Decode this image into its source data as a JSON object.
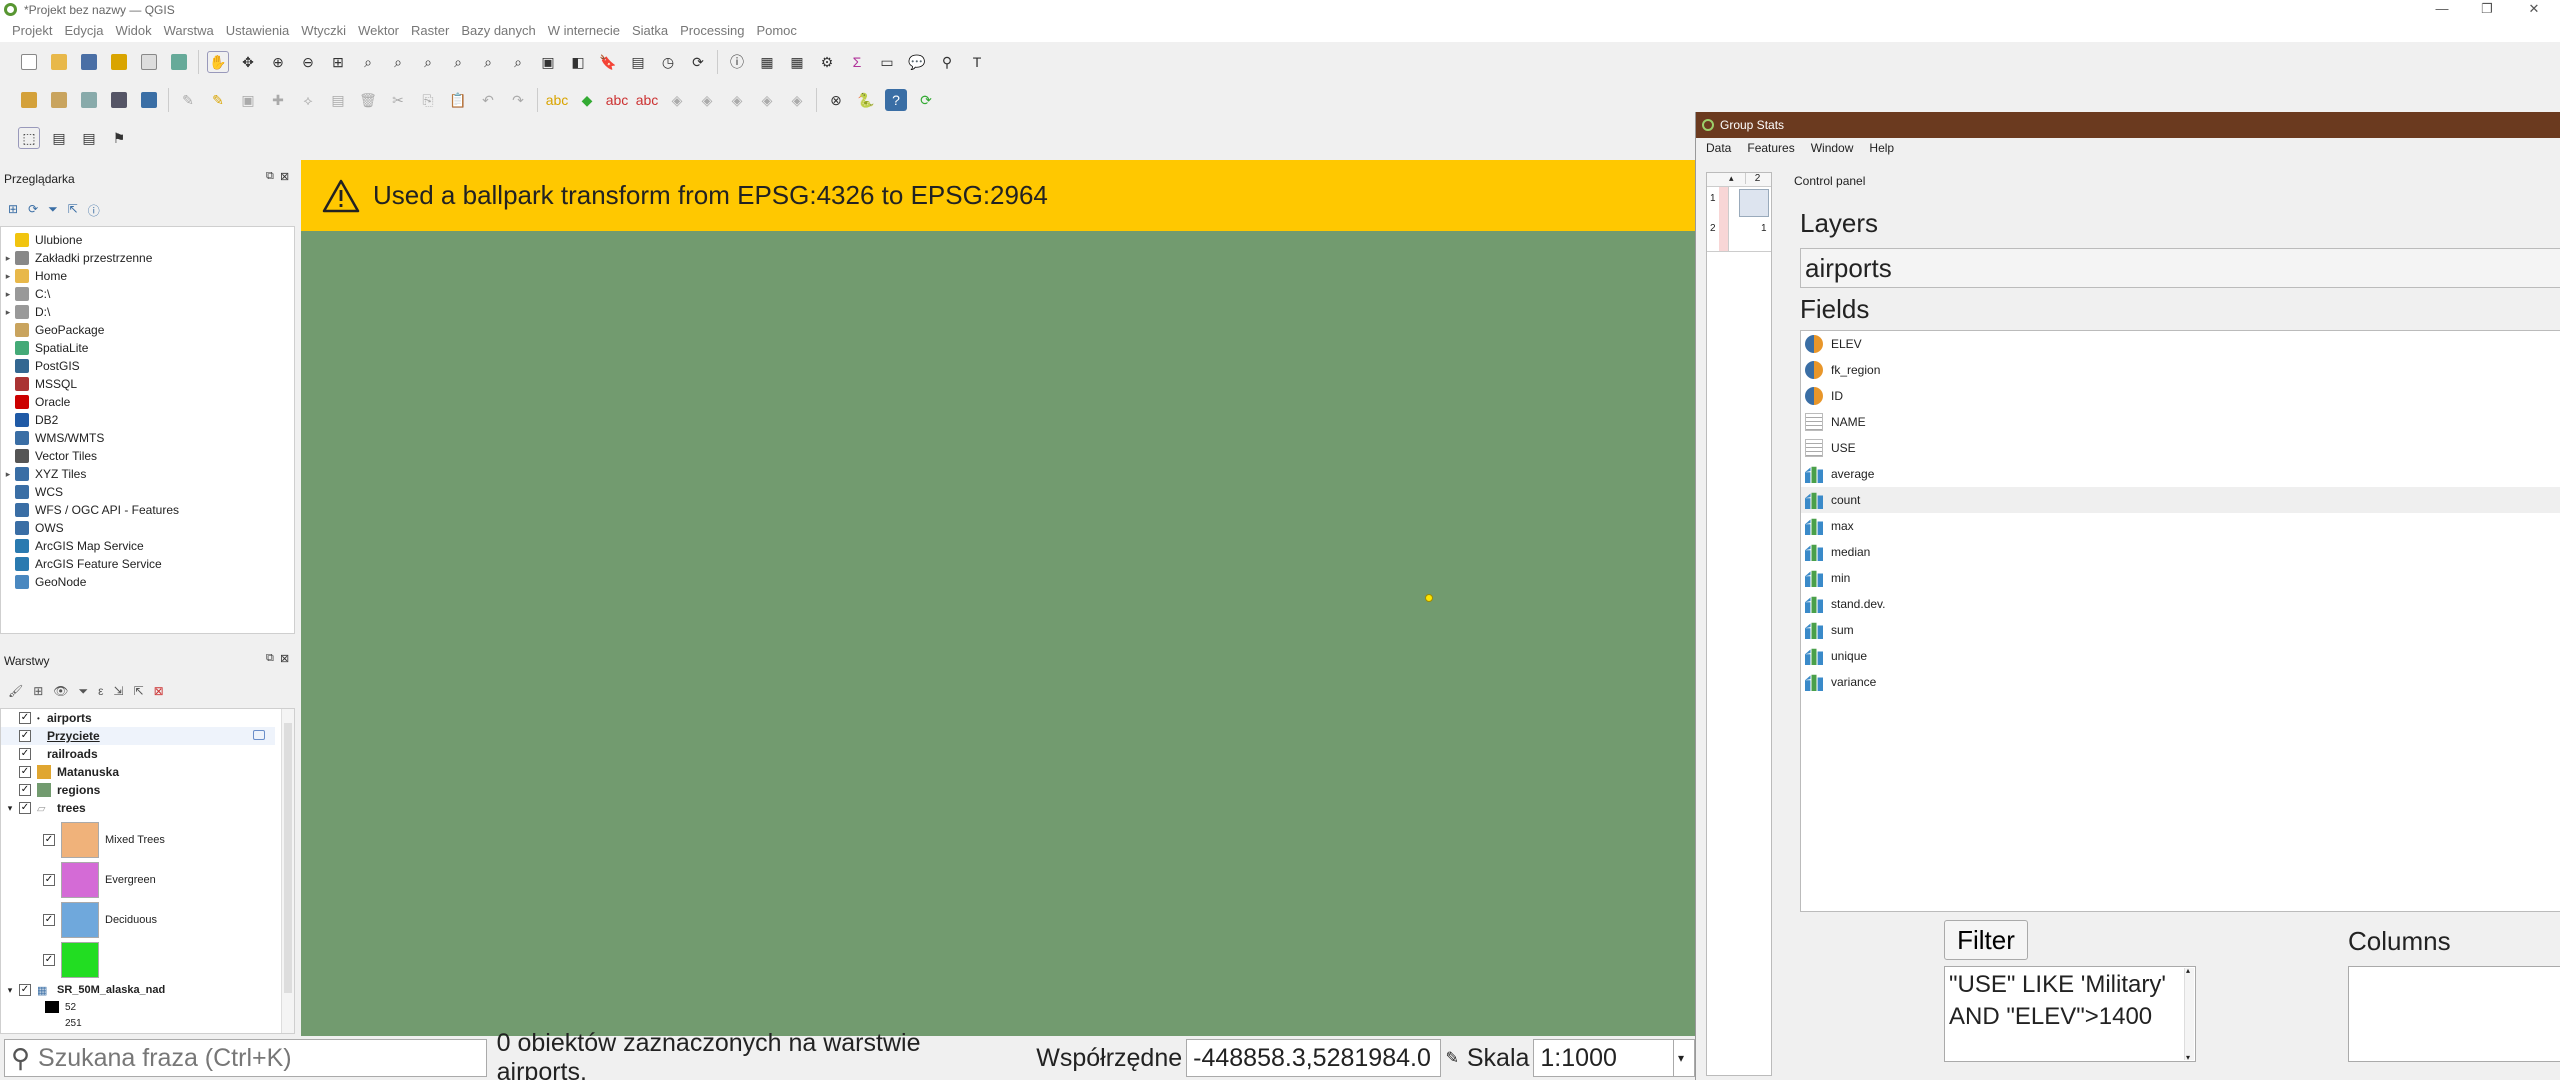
{
  "window": {
    "title": "*Projekt bez nazwy — QGIS"
  },
  "menu": [
    "Projekt",
    "Edycja",
    "Widok",
    "Warstwa",
    "Ustawienia",
    "Wtyczki",
    "Wektor",
    "Raster",
    "Bazy danych",
    "W internecie",
    "Siatka",
    "Processing",
    "Pomoc"
  ],
  "browser": {
    "title": "Przeglądarka",
    "items": [
      {
        "label": "Ulubione",
        "icon": "star-icon",
        "arrow": ""
      },
      {
        "label": "Zakładki przestrzenne",
        "icon": "bookmark-icon",
        "arrow": "▸"
      },
      {
        "label": "Home",
        "icon": "folder-icon",
        "arrow": "▸"
      },
      {
        "label": "C:\\",
        "icon": "drive-icon",
        "arrow": "▸"
      },
      {
        "label": "D:\\",
        "icon": "drive-icon",
        "arrow": "▸"
      },
      {
        "label": "GeoPackage",
        "icon": "geopackage-icon",
        "arrow": ""
      },
      {
        "label": "SpatiaLite",
        "icon": "spatialite-icon",
        "arrow": ""
      },
      {
        "label": "PostGIS",
        "icon": "postgis-icon",
        "arrow": ""
      },
      {
        "label": "MSSQL",
        "icon": "mssql-icon",
        "arrow": ""
      },
      {
        "label": "Oracle",
        "icon": "oracle-icon",
        "arrow": ""
      },
      {
        "label": "DB2",
        "icon": "db2-icon",
        "arrow": ""
      },
      {
        "label": "WMS/WMTS",
        "icon": "wms-icon",
        "arrow": ""
      },
      {
        "label": "Vector Tiles",
        "icon": "vector-tiles-icon",
        "arrow": ""
      },
      {
        "label": "XYZ Tiles",
        "icon": "xyz-tiles-icon",
        "arrow": "▸"
      },
      {
        "label": "WCS",
        "icon": "wcs-icon",
        "arrow": ""
      },
      {
        "label": "WFS / OGC API - Features",
        "icon": "wfs-icon",
        "arrow": ""
      },
      {
        "label": "OWS",
        "icon": "ows-icon",
        "arrow": ""
      },
      {
        "label": "ArcGIS Map Service",
        "icon": "arcgis-map-icon",
        "arrow": ""
      },
      {
        "label": "ArcGIS Feature Service",
        "icon": "arcgis-feature-icon",
        "arrow": ""
      },
      {
        "label": "GeoNode",
        "icon": "geonode-icon",
        "arrow": ""
      }
    ]
  },
  "layers": {
    "title": "Warstwy",
    "items": [
      {
        "label": "airports",
        "bold": true
      },
      {
        "label": "Przyciete",
        "bold": true,
        "underline": true
      },
      {
        "label": "railroads",
        "bold": true
      },
      {
        "label": "Matanuska",
        "bold": true,
        "swatch": "#e0a630"
      },
      {
        "label": "regions",
        "bold": true,
        "swatch": "#729b6f"
      },
      {
        "label": "trees",
        "bold": true
      }
    ],
    "legend": [
      {
        "label": "Mixed Trees",
        "color": "#f0b27a"
      },
      {
        "label": "Evergreen",
        "color": "#d46bd6"
      },
      {
        "label": "Deciduous",
        "color": "#6fa8dc"
      },
      {
        "label": "",
        "color": "#22dd22"
      }
    ],
    "raster": {
      "label": "SR_50M_alaska_nad",
      "v1": "52",
      "v2": "251"
    }
  },
  "warning": {
    "message": "Used a ballpark transform from EPSG:4326 to EPSG:2964",
    "color": "#ffc800"
  },
  "map": {
    "background": "#729b6f"
  },
  "status": {
    "search_placeholder": "Szukana fraza (Ctrl+K)",
    "selection": "0 obiektów zaznaczonych na warstwie airports.",
    "coord_label": "Współrzędne",
    "coord_value": "-448858.3,5281984.0",
    "scale_label": "Skala",
    "scale_value": "1:1000"
  },
  "group_stats": {
    "title": "Group Stats",
    "menu": [
      "Data",
      "Features",
      "Window",
      "Help"
    ],
    "table": {
      "col_header": "2",
      "row1": "1",
      "row2": "2",
      "cell": "1"
    },
    "control_panel": "Control panel",
    "layers_label": "Layers",
    "layer_value": "airports",
    "fields_label": "Fields",
    "fields": [
      {
        "name": "ELEV",
        "type": "number"
      },
      {
        "name": "fk_region",
        "type": "number"
      },
      {
        "name": "ID",
        "type": "number"
      },
      {
        "name": "NAME",
        "type": "text"
      },
      {
        "name": "USE",
        "type": "text"
      },
      {
        "name": "average",
        "type": "calc"
      },
      {
        "name": "count",
        "type": "calc"
      },
      {
        "name": "max",
        "type": "calc"
      },
      {
        "name": "median",
        "type": "calc"
      },
      {
        "name": "min",
        "type": "calc"
      },
      {
        "name": "stand.dev.",
        "type": "calc"
      },
      {
        "name": "sum",
        "type": "calc"
      },
      {
        "name": "unique",
        "type": "calc"
      },
      {
        "name": "variance",
        "type": "calc"
      }
    ],
    "filter_button": "Filter",
    "filter_text": "\"USE\" LIKE 'Military' AND \"ELEV\">1400",
    "columns_label": "Columns"
  }
}
